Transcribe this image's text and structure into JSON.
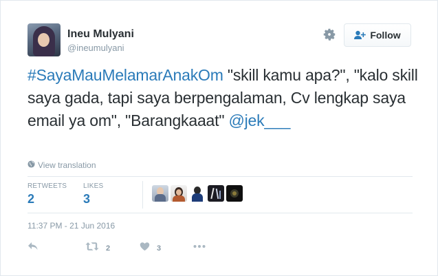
{
  "user": {
    "name": "Ineu Mulyani",
    "handle": "@ineumulyani"
  },
  "follow_label": "Follow",
  "tweet": {
    "hashtag": "#SayaMauMelamarAnakOm",
    "body": " \"skill kamu apa?\", \"kalo skill saya gada, tapi saya berpengalaman, Cv lengkap saya email ya om\", \"Barangkaaat\" ",
    "mention": "@jek___"
  },
  "view_translation": "View translation",
  "stats": {
    "retweets_label": "RETWEETS",
    "retweets": "2",
    "likes_label": "LIKES",
    "likes": "3"
  },
  "liked_by_avatars": 5,
  "timestamp": "11:37 PM - 21 Jun 2016",
  "actions": {
    "retweet_count": "2",
    "like_count": "3"
  },
  "colors": {
    "link": "#2b7bb9",
    "muted": "#8899a6",
    "text": "#292f33",
    "border": "#e1e8ed"
  },
  "icons": [
    "settings-gear-icon",
    "follow-person-plus-icon",
    "globe-icon",
    "reply-icon",
    "retweet-icon",
    "heart-icon",
    "more-icon"
  ]
}
